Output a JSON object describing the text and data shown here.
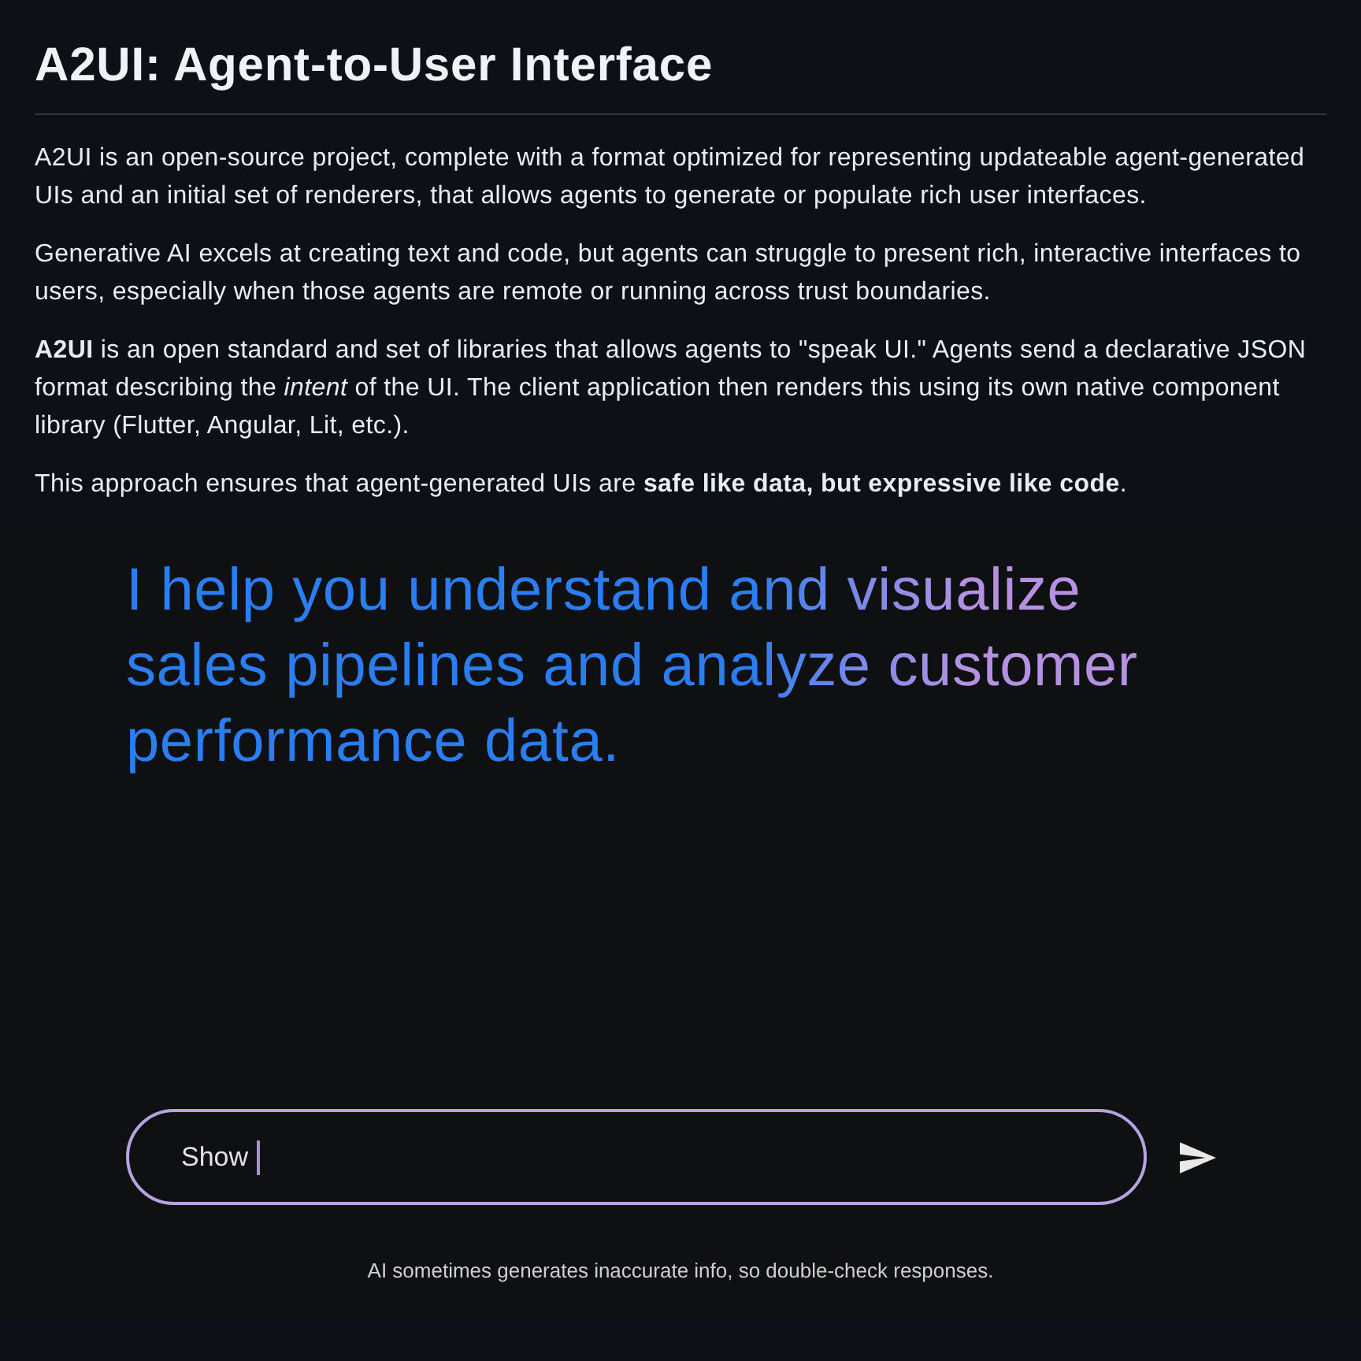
{
  "page": {
    "title": "A2UI: Agent-to-User Interface",
    "paragraphs": [
      "A2UI is an open-source project, complete with a format optimized for representing updateable agent-generated UIs and an initial set of renderers, that allows agents to generate or populate rich user interfaces.",
      "Generative AI excels at creating text and code, but agents can struggle to present rich, interactive interfaces to users, especially when those agents are remote or running across trust boundaries.",
      "**A2UI** is an open standard and set of libraries that allows agents to \"speak UI.\" Agents send a declarative JSON format describing the *intent* of the UI. The client application then renders this using its own native component library (Flutter, Angular, Lit, etc.).",
      "This approach ensures that agent-generated UIs are **safe like data, but expressive like code**."
    ]
  },
  "chat": {
    "intro": "I help you understand and visualize sales pipelines and analyze customer performance data.",
    "input": {
      "value": "Show"
    },
    "disclaimer": "AI sometimes generates inaccurate info, so double-check responses."
  }
}
